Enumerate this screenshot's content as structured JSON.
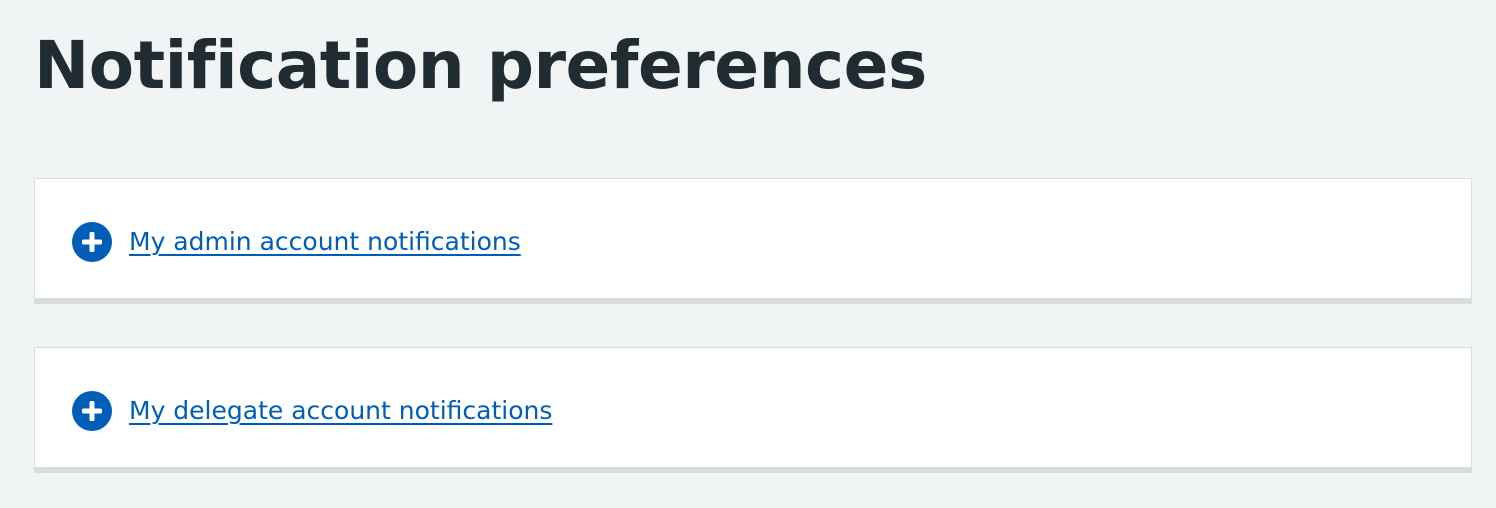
{
  "page": {
    "title": "Notification preferences"
  },
  "sections": [
    {
      "label": "My admin account notifications",
      "icon": "plus-circle-icon",
      "expanded": false
    },
    {
      "label": "My delegate account notifications",
      "icon": "plus-circle-icon",
      "expanded": false
    }
  ],
  "colors": {
    "background": "#f0f4f5",
    "text": "#212b32",
    "link": "#005eb8",
    "card": "#ffffff",
    "card_border": "#d8dde0"
  }
}
